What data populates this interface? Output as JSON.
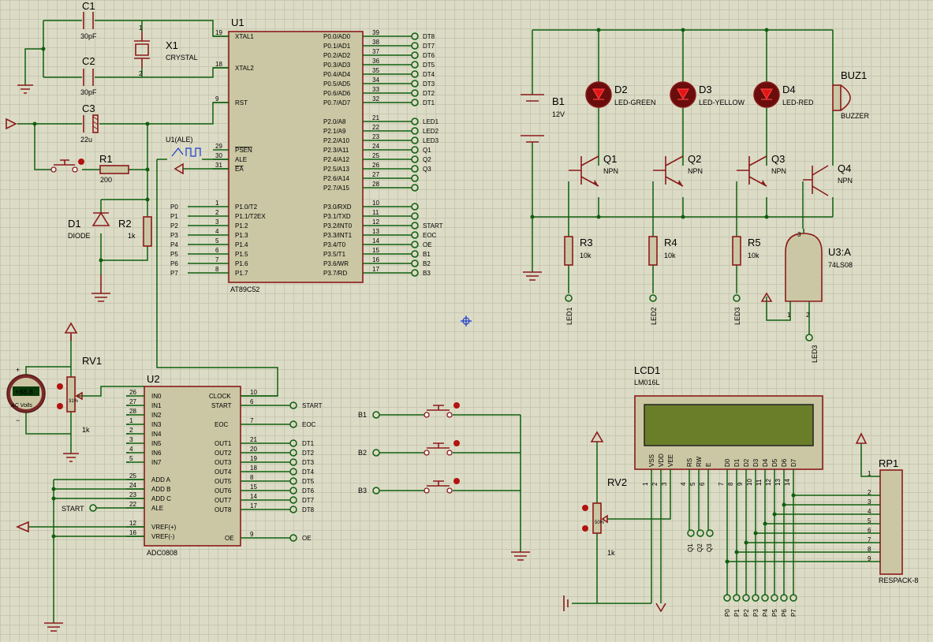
{
  "u1": {
    "ref": "U1",
    "name": "AT89C52",
    "left": [
      {
        "pin": "19",
        "name": "XTAL1"
      },
      {
        "pin": "18",
        "name": "XTAL2"
      },
      {
        "pin": "9",
        "name": "RST"
      },
      {
        "pin": "29",
        "name": "PSEN"
      },
      {
        "pin": "30",
        "name": "ALE"
      },
      {
        "pin": "31",
        "name": "EA"
      },
      {
        "pin": "1",
        "name": "P1.0/T2"
      },
      {
        "pin": "2",
        "name": "P1.1/T2EX"
      },
      {
        "pin": "3",
        "name": "P1.2"
      },
      {
        "pin": "4",
        "name": "P1.3"
      },
      {
        "pin": "5",
        "name": "P1.4"
      },
      {
        "pin": "6",
        "name": "P1.5"
      },
      {
        "pin": "7",
        "name": "P1.6"
      },
      {
        "pin": "8",
        "name": "P1.7"
      }
    ],
    "right": [
      {
        "pin": "39",
        "name": "P0.0/AD0",
        "net": "DT8"
      },
      {
        "pin": "38",
        "name": "P0.1/AD1",
        "net": "DT7"
      },
      {
        "pin": "37",
        "name": "P0.2/AD2",
        "net": "DT6"
      },
      {
        "pin": "36",
        "name": "P0.3/AD3",
        "net": "DT5"
      },
      {
        "pin": "35",
        "name": "P0.4/AD4",
        "net": "DT4"
      },
      {
        "pin": "34",
        "name": "P0.5/AD5",
        "net": "DT3"
      },
      {
        "pin": "33",
        "name": "P0.6/AD6",
        "net": "DT2"
      },
      {
        "pin": "32",
        "name": "P0.7/AD7",
        "net": "DT1"
      },
      {
        "pin": "21",
        "name": "P2.0/A8",
        "net": "LED1"
      },
      {
        "pin": "22",
        "name": "P2.1/A9",
        "net": "LED2"
      },
      {
        "pin": "23",
        "name": "P2.2/A10",
        "net": "LED3"
      },
      {
        "pin": "24",
        "name": "P2.3/A11",
        "net": "Q1"
      },
      {
        "pin": "25",
        "name": "P2.4/A12",
        "net": "Q2"
      },
      {
        "pin": "26",
        "name": "P2.5/A13",
        "net": "Q3"
      },
      {
        "pin": "27",
        "name": "P2.6/A14",
        "net": ""
      },
      {
        "pin": "28",
        "name": "P2.7/A15",
        "net": ""
      },
      {
        "pin": "10",
        "name": "P3.0/RXD",
        "net": ""
      },
      {
        "pin": "11",
        "name": "P3.1/TXD",
        "net": ""
      },
      {
        "pin": "12",
        "name": "P3.2/INT0",
        "net": "START"
      },
      {
        "pin": "13",
        "name": "P3.3/INT1",
        "net": "EOC"
      },
      {
        "pin": "14",
        "name": "P3.4/T0",
        "net": "OE"
      },
      {
        "pin": "15",
        "name": "P3.5/T1",
        "net": "B1"
      },
      {
        "pin": "16",
        "name": "P3.6/WR",
        "net": "B2"
      },
      {
        "pin": "17",
        "name": "P3.7/RD",
        "net": "B3"
      }
    ],
    "p1_nets": [
      "P0",
      "P1",
      "P2",
      "P3",
      "P4",
      "P5",
      "P6",
      "P7"
    ],
    "probe": "U1(ALE)"
  },
  "crystal": {
    "c1": "C1",
    "c1v": "30pF",
    "c2": "C2",
    "c2v": "30pF",
    "x1": "X1",
    "x1v": "CRYSTAL",
    "c3": "C3",
    "c3v": "22u",
    "r1": "R1",
    "r1v": "200",
    "d1": "D1",
    "d1v": "DIODE",
    "r2": "R2",
    "r2v": "1k",
    "xpin1": "1",
    "xpin2": "2"
  },
  "u2": {
    "ref": "U2",
    "name": "ADC0808",
    "left": [
      {
        "pin": "26",
        "name": "IN0"
      },
      {
        "pin": "27",
        "name": "IN1"
      },
      {
        "pin": "28",
        "name": "IN2"
      },
      {
        "pin": "1",
        "name": "IN3"
      },
      {
        "pin": "2",
        "name": "IN4"
      },
      {
        "pin": "3",
        "name": "IN5"
      },
      {
        "pin": "4",
        "name": "IN6"
      },
      {
        "pin": "5",
        "name": "IN7"
      },
      {
        "pin": "25",
        "name": "ADD A"
      },
      {
        "pin": "24",
        "name": "ADD B"
      },
      {
        "pin": "23",
        "name": "ADD C"
      },
      {
        "pin": "22",
        "name": "ALE"
      },
      {
        "pin": "12",
        "name": "VREF(+)"
      },
      {
        "pin": "16",
        "name": "VREF(-)"
      }
    ],
    "right": [
      {
        "pin": "10",
        "name": "CLOCK",
        "net": ""
      },
      {
        "pin": "6",
        "name": "START",
        "net": "START"
      },
      {
        "pin": "7",
        "name": "EOC",
        "net": "EOC"
      },
      {
        "pin": "21",
        "name": "OUT1",
        "net": "DT1"
      },
      {
        "pin": "20",
        "name": "OUT2",
        "net": "DT2"
      },
      {
        "pin": "19",
        "name": "OUT3",
        "net": "DT3"
      },
      {
        "pin": "18",
        "name": "OUT4",
        "net": "DT4"
      },
      {
        "pin": "8",
        "name": "OUT5",
        "net": "DT5"
      },
      {
        "pin": "15",
        "name": "OUT6",
        "net": "DT6"
      },
      {
        "pin": "14",
        "name": "OUT7",
        "net": "DT7"
      },
      {
        "pin": "17",
        "name": "OUT8",
        "net": "DT8"
      },
      {
        "pin": "9",
        "name": "OE",
        "net": "OE"
      }
    ],
    "ale_net": "START"
  },
  "rv1": {
    "ref": "RV1",
    "value": "1k",
    "pct": "31%",
    "meter": "AC Volts",
    "reading": "+88.8",
    "plus": "+",
    "minus": "−"
  },
  "buttons": [
    "B1",
    "B2",
    "B3"
  ],
  "right_top": {
    "b1": "B1",
    "b1v": "12V",
    "leds": [
      {
        "ref": "D2",
        "value": "LED-GREEN"
      },
      {
        "ref": "D3",
        "value": "LED-YELLOW"
      },
      {
        "ref": "D4",
        "value": "LED-RED"
      }
    ],
    "buz": "BUZ1",
    "buzv": "BUZZER",
    "q": [
      {
        "ref": "Q1",
        "value": "NPN"
      },
      {
        "ref": "Q2",
        "value": "NPN"
      },
      {
        "ref": "Q3",
        "value": "NPN"
      },
      {
        "ref": "Q4",
        "value": "NPN"
      }
    ],
    "r": [
      {
        "ref": "R3",
        "value": "10k",
        "net": "LED1"
      },
      {
        "ref": "R4",
        "value": "10k",
        "net": "LED2"
      },
      {
        "ref": "R5",
        "value": "10k",
        "net": "LED3"
      }
    ],
    "u3": "U3:A",
    "u3v": "74LS08",
    "u3_out": "3",
    "u3_in1": "1",
    "u3_in2": "2",
    "u3_net": "LED3"
  },
  "lcd": {
    "ref": "LCD1",
    "value": "LM016L",
    "pins": [
      {
        "name": "VSS",
        "num": "1"
      },
      {
        "name": "VDD",
        "num": "2"
      },
      {
        "name": "VEE",
        "num": "3"
      },
      {
        "name": "RS",
        "num": "4"
      },
      {
        "name": "RW",
        "num": "5"
      },
      {
        "name": "E",
        "num": "6"
      },
      {
        "name": "D0",
        "num": "7"
      },
      {
        "name": "D1",
        "num": "8"
      },
      {
        "name": "D2",
        "num": "9"
      },
      {
        "name": "D3",
        "num": "10"
      },
      {
        "name": "D4",
        "num": "11"
      },
      {
        "name": "D5",
        "num": "12"
      },
      {
        "name": "D6",
        "num": "13"
      },
      {
        "name": "D7",
        "num": "14"
      }
    ],
    "ctrl_nets": [
      "Q1",
      "Q2",
      "Q3"
    ],
    "data_nets": [
      "P0",
      "P1",
      "P2",
      "P3",
      "P4",
      "P5",
      "P6",
      "P7"
    ]
  },
  "rv2": {
    "ref": "RV2",
    "value": "1k",
    "pct": "50%"
  },
  "rp1": {
    "ref": "RP1",
    "value": "RESPACK-8",
    "pins": [
      "1",
      "2",
      "3",
      "4",
      "5",
      "6",
      "7",
      "8",
      "9"
    ]
  }
}
